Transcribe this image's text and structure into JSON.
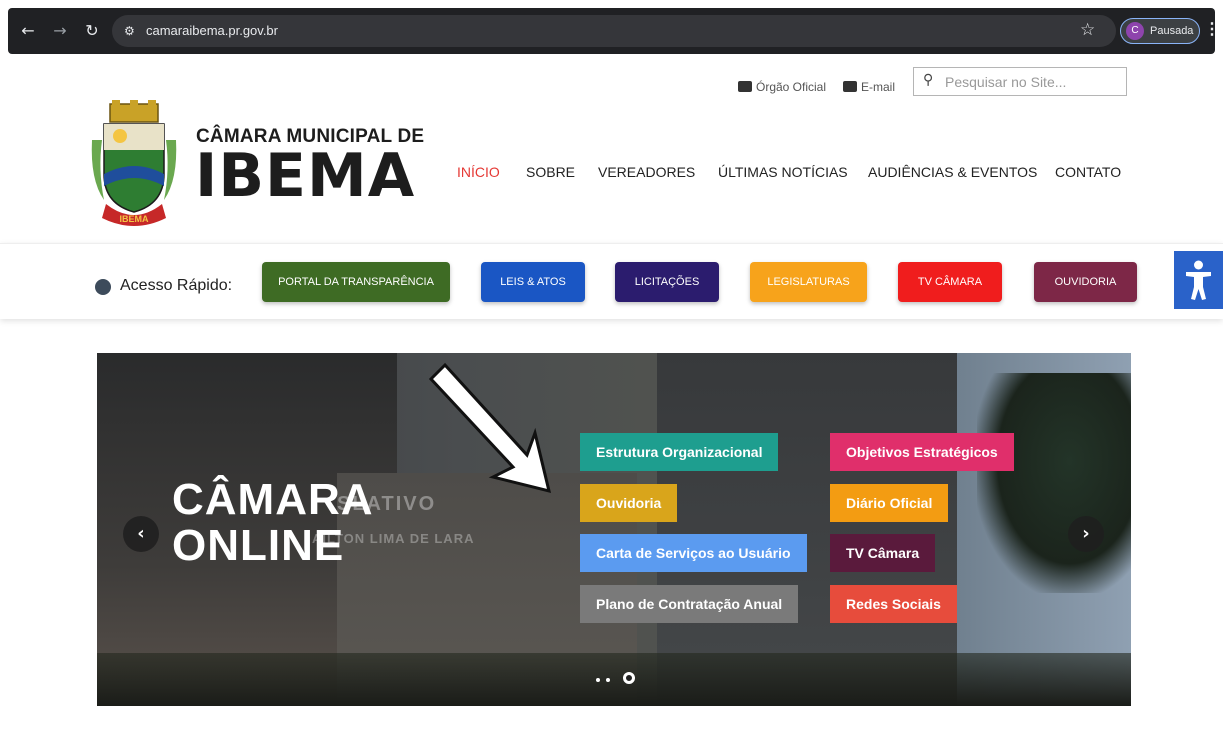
{
  "browser": {
    "url": "camaraibema.pr.gov.br",
    "profile_initial": "C",
    "profile_status": "Pausada"
  },
  "header": {
    "official_link": "Órgão Oficial",
    "email_link": "E-mail",
    "search_placeholder": "Pesquisar no Site...",
    "brand_small": "CÂMARA MUNICIPAL DE",
    "brand_big": "IBEMA",
    "logo_text": "IBEMA"
  },
  "menu": {
    "items": [
      {
        "label": "INÍCIO",
        "active": true
      },
      {
        "label": "SOBRE",
        "active": false
      },
      {
        "label": "VEREADORES",
        "active": false
      },
      {
        "label": "ÚLTIMAS NOTÍCIAS",
        "active": false
      },
      {
        "label": "AUDIÊNCIAS & EVENTOS",
        "active": false
      },
      {
        "label": "CONTATO",
        "active": false
      }
    ],
    "active_color": "#e53935"
  },
  "quick_access": {
    "label": "Acesso Rápido:",
    "buttons": [
      {
        "label": "PORTAL DA TRANSPARÊNCIA",
        "color": "#3e6b24"
      },
      {
        "label": "LEIS & ATOS",
        "color": "#1a56c4"
      },
      {
        "label": "LICITAÇÕES",
        "color": "#2b1c6e"
      },
      {
        "label": "LEGISLATURAS",
        "color": "#f7a31b"
      },
      {
        "label": "TV CÂMARA",
        "color": "#f01d1d"
      },
      {
        "label": "OUVIDORIA",
        "color": "#7d2747"
      }
    ]
  },
  "hero": {
    "title_line1": "CÂMARA",
    "title_line2": "ONLINE",
    "sign_text": "SLATIVO",
    "sign_text2": "AILTON LIMA DE LARA",
    "prev_label": "‹",
    "next_label": "›",
    "tags": [
      {
        "label": "Estrutura Organizacional",
        "color": "#1e9e8f"
      },
      {
        "label": "Objetivos Estratégicos",
        "color": "#e02f6b"
      },
      {
        "label": "Ouvidoria",
        "color": "#d9a51b"
      },
      {
        "label": "Diário Oficial",
        "color": "#f39c12"
      },
      {
        "label": "Carta de Serviços ao Usuário",
        "color": "#5b9bf0"
      },
      {
        "label": "TV Câmara",
        "color": "#5a1a3c"
      },
      {
        "label": "Plano de Contratação Anual",
        "color": "#7a7a7a"
      },
      {
        "label": "Redes Sociais",
        "color": "#e74c3c"
      }
    ],
    "active_slide": 3,
    "slide_count": 3
  },
  "accessibility": {
    "icon": "accessibility-icon",
    "color": "#2a62c9"
  }
}
